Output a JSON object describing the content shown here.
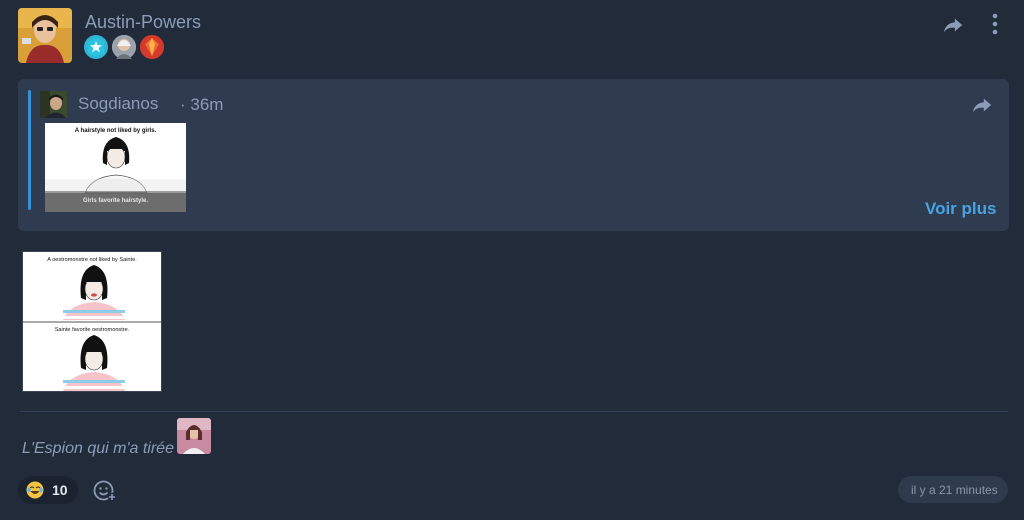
{
  "post": {
    "author": "Austin-Powers",
    "caption": "L'Espion qui m'a tirée",
    "timestamp": "il y a 21 minutes",
    "badges": [
      "star-badge",
      "elder-badge",
      "red-gem-badge"
    ]
  },
  "quote": {
    "author": "Sogdianos",
    "time": "· 36m",
    "image_top_caption": "A hairstyle not liked by girls.",
    "image_bottom_caption": "Girls favorite hairstyle.",
    "more_label": "Voir plus"
  },
  "image": {
    "top_caption": "A oestromonstre not liked by Sainte.",
    "bottom_caption": "Sainte favorite oestromonstre."
  },
  "reactions": {
    "emoji": "laughing-crying-emoji",
    "count": "10"
  },
  "colors": {
    "background": "#222b3a",
    "card": "#2f3b4e",
    "accent": "#4aa3e3",
    "muted_text": "#8c9cb7"
  }
}
